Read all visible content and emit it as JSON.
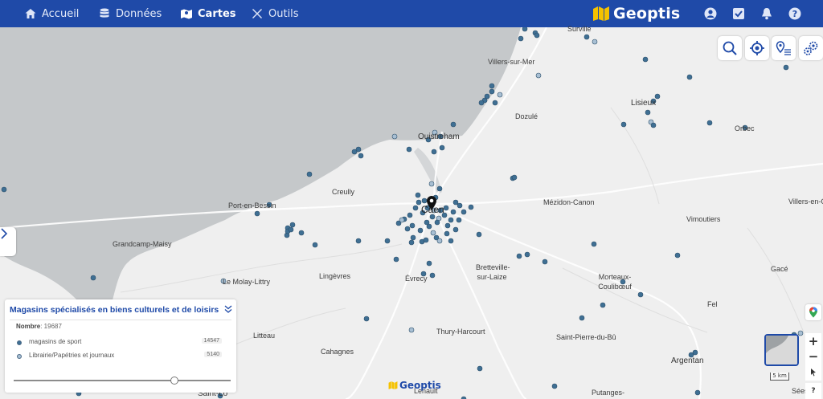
{
  "nav": {
    "items": [
      {
        "label": "Accueil",
        "icon": "home-icon"
      },
      {
        "label": "Données",
        "icon": "database-icon"
      },
      {
        "label": "Cartes",
        "icon": "map-icon"
      },
      {
        "label": "Outils",
        "icon": "tools-icon"
      }
    ],
    "active": "Cartes",
    "brand": "Geoptis",
    "right_icons": [
      "user-icon",
      "tasks-icon",
      "bell-icon",
      "help-icon"
    ]
  },
  "colors": {
    "nav_bg": "#1f4aa8",
    "sea": "#c4c7c9",
    "land": "#efefef",
    "point_sport": "#3f6f93",
    "point_librairie": "#a8bfd3",
    "brand_yellow": "#f5c200",
    "panel_title": "#1f4aa8"
  },
  "map": {
    "places": [
      {
        "name": "Surville",
        "size": "small"
      },
      {
        "name": "Villers-sur-Mer",
        "size": "small"
      },
      {
        "name": "Lisieux",
        "size": "mid"
      },
      {
        "name": "Dozulé",
        "size": "small"
      },
      {
        "name": "Ouistreham",
        "size": "mid"
      },
      {
        "name": "Orbec",
        "size": "small"
      },
      {
        "name": "Creully",
        "size": "small"
      },
      {
        "name": "Port-en-Bessin",
        "size": "small"
      },
      {
        "name": "Caen",
        "size": "big"
      },
      {
        "name": "Mézidon-Canon",
        "size": "small"
      },
      {
        "name": "Villers-en-Ouche",
        "size": "small"
      },
      {
        "name": "Vimoutiers",
        "size": "small"
      },
      {
        "name": "Grandcamp-Maisy",
        "size": "small"
      },
      {
        "name": "Bretteville-sur-Laize",
        "size": "small"
      },
      {
        "name": "Gacé",
        "size": "small"
      },
      {
        "name": "Le Molay-Littry",
        "size": "small"
      },
      {
        "name": "Lingèvres",
        "size": "small"
      },
      {
        "name": "Évrecy",
        "size": "small"
      },
      {
        "name": "Morteaux-Coulibœuf",
        "size": "small"
      },
      {
        "name": "Fel",
        "size": "small"
      },
      {
        "name": "Litteau",
        "size": "small"
      },
      {
        "name": "Thury-Harcourt",
        "size": "small"
      },
      {
        "name": "Cahagnes",
        "size": "small"
      },
      {
        "name": "Saint-Pierre-du-Bû",
        "size": "small"
      },
      {
        "name": "Argentan",
        "size": "mid"
      },
      {
        "name": "Saint-Lô",
        "size": "mid"
      },
      {
        "name": "Putanges-",
        "size": "small"
      },
      {
        "name": "Sées",
        "size": "small"
      },
      {
        "name": "Lenault",
        "size": "small"
      }
    ],
    "scale_label": "5 km",
    "controls": [
      "search-icon",
      "locate-icon",
      "pin-list-icon",
      "settings-gears-icon"
    ],
    "zoom_in": "+",
    "zoom_out": "−",
    "help": "?",
    "watermark": "Geoptis"
  },
  "legend": {
    "title": "Magasins spécialisés en biens culturels et de loisirs",
    "count_label": "Nombre",
    "count_value": ": 19687",
    "items": [
      {
        "label": "magasins de sport",
        "value": "14547",
        "color": "#3f6f93"
      },
      {
        "label": "Librairie/Papétries et journaux",
        "value": "5140",
        "color": "#a8bfd3"
      }
    ],
    "opacity_level": 0.75
  }
}
